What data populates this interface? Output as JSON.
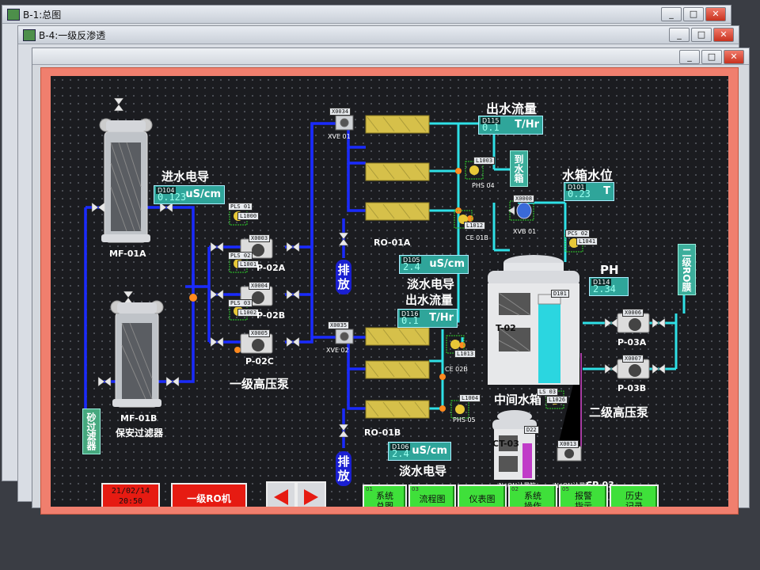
{
  "windows": {
    "back": {
      "title": "B-1:总图"
    },
    "main": {
      "title": "B-4:一级反渗透"
    }
  },
  "window_controls": {
    "minimize": "_",
    "maximize": "□",
    "close": "✕"
  },
  "labels": {
    "mf01a": "MF-01A",
    "mf01b": "MF-01B",
    "security_filter": "保安过滤器",
    "sand_filter": "砂过滤器",
    "inlet_conductivity": "进水电导",
    "p02a": "P-02A",
    "p02b": "P-02B",
    "p02c": "P-02C",
    "hp_pump_1": "一级高压泵",
    "ro01a": "RO-01A",
    "ro01b": "RO-01B",
    "drain_1": "排放",
    "drain_2": "排放",
    "fresh_conductivity_1": "淡水电导",
    "fresh_conductivity_2": "淡水电导",
    "outlet_flow_1": "出水流量",
    "outlet_flow_2": "出水流量",
    "tank_level": "水箱水位",
    "ph": "PH",
    "t02": "T-02",
    "mid_tank": "中间水箱",
    "p03a": "P-03A",
    "p03b": "P-03B",
    "hp_pump_2": "二级高压泵",
    "ct03": "CT-03",
    "naoh_tank": "NaOH计量箱",
    "naoh_pump": "NaOH计量泵",
    "cp03": "CP-03",
    "to_tank": "到水箱",
    "to_ro2": "二级RO膜",
    "xve01": "XVE 01",
    "xve02": "XVE 02",
    "xvb01": "XVB 01",
    "pls01": "PLS 01",
    "pls02": "PLS 02",
    "pls03": "PLS 03",
    "pcs02": "PCS 02",
    "phs04": "PHS 04",
    "phs05": "PHS 05",
    "ce01b": "CE 01B",
    "ce02b": "CE 02B",
    "ls03": "LS 03"
  },
  "indicators": {
    "d104": {
      "tag": "D104",
      "value": "0.123",
      "unit": "uS/cm"
    },
    "d105": {
      "tag": "D105",
      "value": "2.4",
      "unit": "uS/cm"
    },
    "d106": {
      "tag": "D106",
      "value": "2.4",
      "unit": "uS/cm"
    },
    "d115": {
      "tag": "D115",
      "value": "0.1",
      "unit": "T/Hr"
    },
    "d116": {
      "tag": "D116",
      "value": "0.1",
      "unit": "T/Hr"
    },
    "d101": {
      "tag": "D101",
      "value": "0.23",
      "unit": "T"
    },
    "d114": {
      "tag": "D114",
      "value": "2.34",
      "unit": ""
    }
  },
  "tags": {
    "x0034": "X0034",
    "x0035": "X0035",
    "x0003": "X0003",
    "x0004": "X0004",
    "x0005": "X0005",
    "x0006": "X0006",
    "x0007": "X0007",
    "x0008": "X0008",
    "x0013": "X0013",
    "l1000": "L1000",
    "l1001": "L1001",
    "l1002": "L1002",
    "l1003": "L1003",
    "l1004": "L1004",
    "l1012": "L1012",
    "l1013": "L1013",
    "l1041": "L1041",
    "l1026": "L1026",
    "d101t": "D101",
    "d22": "D22"
  },
  "footer": {
    "date": "21/02/14",
    "time": "20:50",
    "ro_button": "一级RO机",
    "nav": [
      {
        "num": "01",
        "line1": "系统",
        "line2": "总图"
      },
      {
        "num": "03",
        "line1": "流程图",
        "line2": ""
      },
      {
        "num": "",
        "line1": "仪表图",
        "line2": ""
      },
      {
        "num": "02",
        "line1": "系统",
        "line2": "操作"
      },
      {
        "num": "05",
        "line1": "报警",
        "line2": "指示"
      },
      {
        "num": "",
        "line1": "历史",
        "line2": "记录"
      }
    ]
  },
  "colors": {
    "pipe_blue": "#1a2bff",
    "pipe_cyan": "#2fe0e6",
    "screen_bg": "#1b1c20",
    "frame_red": "#f07f6e",
    "nav_green": "#3fe03a",
    "alarm_red": "#e61b12"
  }
}
